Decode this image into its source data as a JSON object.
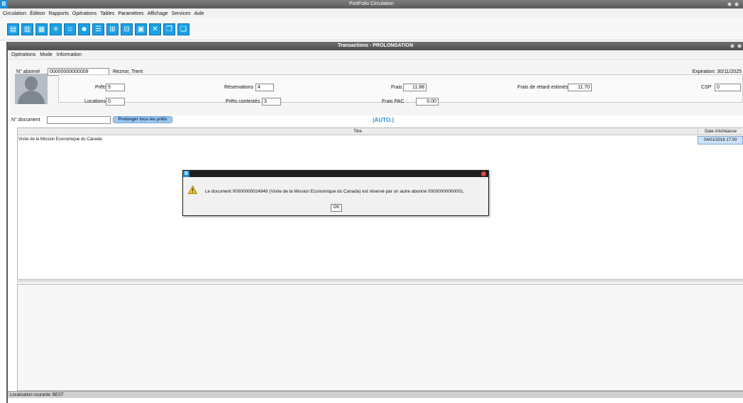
{
  "app": {
    "title": "PortFolio Circulation",
    "logo": "B",
    "menu": [
      "Circulation",
      "Édition",
      "Rapports",
      "Opérations",
      "Tables",
      "Paramètres",
      "Affichage",
      "Services",
      "Aide"
    ],
    "toolbar_icons": [
      "checkout-icon",
      "checkin-icon",
      "renew-icon",
      "reservation-icon",
      "patron-icon",
      "patron-add-icon",
      "list-icon",
      "bill-icon",
      "bill-pay-icon",
      "report-icon",
      "tools-icon",
      "copy-icon",
      "paste-icon"
    ]
  },
  "window": {
    "title": "Transactions - PROLONGATION",
    "menu": [
      "Opérations",
      "Mode",
      "Information"
    ]
  },
  "patron": {
    "number_label": "N° abonné",
    "number_value": "00000000000009",
    "name": "Reznor, Trent",
    "expiration": "Expiration: 30/11/2025"
  },
  "stats": {
    "loans_label": "Prêts",
    "loans_value": "5",
    "rentals_label": "Locations",
    "rentals_value": "0",
    "reservations_label": "Réservations",
    "reservations_value": "4",
    "contested_label": "Prêts contestés",
    "contested_value": "3",
    "fees_label": "Frais",
    "fees_value": "11.88",
    "pac_label": "Frais PAC",
    "pac_value": "0.00",
    "late_label": "Frais de retard estimés",
    "late_value": "11.70",
    "csp_label": "CSP",
    "csp_value": "0"
  },
  "document": {
    "label": "N° document",
    "value": "",
    "extend_all": "Prolonger tous les prêts",
    "mode": "(AUTO.)"
  },
  "table": {
    "col_title": "Titre",
    "col_due": "Date d'échéance",
    "rows": [
      {
        "title": "Visite de la Mission Economique du Canada",
        "due": "04/01/2016  17:00"
      }
    ]
  },
  "status": {
    "location": "Localisation courante: BEST"
  },
  "dialog": {
    "logo": "B",
    "message": "Le document 00000000024949 (Visite de la Mission Economique du Canada) est réservé par un autre abonné 00000000000001.",
    "ok": "OK"
  }
}
